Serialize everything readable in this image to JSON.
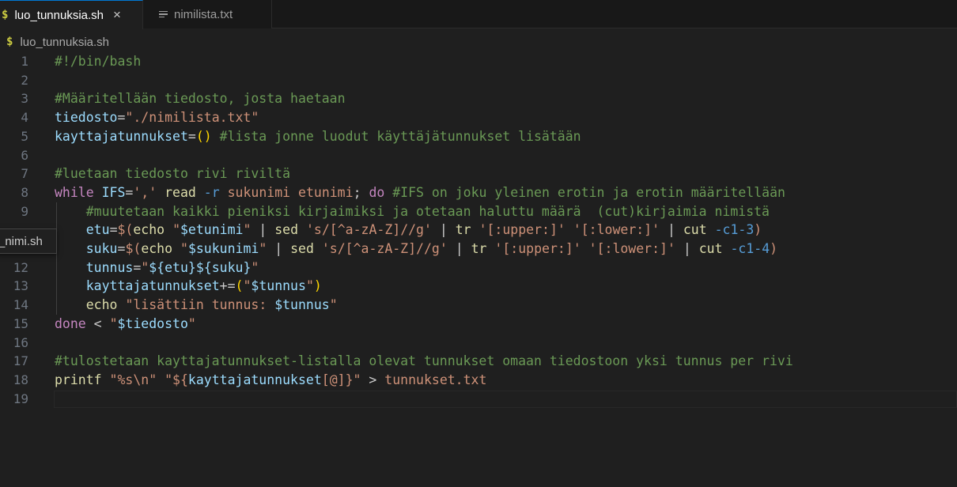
{
  "tabs": [
    {
      "icon": "$",
      "label": "luo_tunnuksia.sh",
      "active": true,
      "close": "×"
    },
    {
      "icon": "lines-icon",
      "label": "nimilista.txt",
      "active": false
    }
  ],
  "breadcrumb": {
    "icon": "$",
    "label": "luo_tunnuksia.sh"
  },
  "tooltip": {
    "text": "_nimi.sh"
  },
  "editor": {
    "line_numbers": [
      "1",
      "2",
      "3",
      "4",
      "5",
      "6",
      "7",
      "8",
      "9",
      "",
      "",
      "12",
      "13",
      "14",
      "15",
      "16",
      "17",
      "18",
      "19"
    ],
    "lines": [
      [
        [
          "cm",
          "#!/bin/bash"
        ]
      ],
      [],
      [
        [
          "cm",
          "#Määritellään tiedosto, josta haetaan"
        ]
      ],
      [
        [
          "var",
          "tiedosto"
        ],
        [
          "pl",
          "="
        ],
        [
          "str",
          "\"./nimilista.txt\""
        ]
      ],
      [
        [
          "var",
          "kayttajatunnukset"
        ],
        [
          "pl",
          "="
        ],
        [
          "br",
          "()"
        ],
        [
          "pl",
          " "
        ],
        [
          "cm",
          "#lista jonne luodut käyttäjätunnukset lisätään"
        ]
      ],
      [],
      [
        [
          "cm",
          "#luetaan tiedosto rivi riviltä"
        ]
      ],
      [
        [
          "kw",
          "while"
        ],
        [
          "pl",
          " "
        ],
        [
          "var",
          "IFS"
        ],
        [
          "pl",
          "="
        ],
        [
          "str",
          "','"
        ],
        [
          "pl",
          " "
        ],
        [
          "fn",
          "read"
        ],
        [
          "pl",
          " "
        ],
        [
          "op",
          "-r"
        ],
        [
          "pl",
          " "
        ],
        [
          "str",
          "sukunimi etunimi"
        ],
        [
          "pl",
          "; "
        ],
        [
          "kw",
          "do"
        ],
        [
          "pl",
          " "
        ],
        [
          "cm",
          "#IFS on joku yleinen erotin ja erotin määritellään"
        ]
      ],
      [
        [
          "pl",
          "    "
        ],
        [
          "cm",
          "#muutetaan kaikki pieniksi kirjaimiksi ja otetaan haluttu määrä  (cut)kirjaimia nimistä"
        ]
      ],
      [
        [
          "pl",
          "    "
        ],
        [
          "var",
          "etu"
        ],
        [
          "pl",
          "="
        ],
        [
          "str",
          "$("
        ],
        [
          "fn",
          "echo"
        ],
        [
          "pl",
          " "
        ],
        [
          "str",
          "\""
        ],
        [
          "var",
          "$etunimi"
        ],
        [
          "str",
          "\""
        ],
        [
          "pl",
          " | "
        ],
        [
          "fn",
          "sed"
        ],
        [
          "pl",
          " "
        ],
        [
          "str",
          "'s/[^a-zA-Z]//g'"
        ],
        [
          "pl",
          " | "
        ],
        [
          "fn",
          "tr"
        ],
        [
          "pl",
          " "
        ],
        [
          "str",
          "'[:upper:]'"
        ],
        [
          "pl",
          " "
        ],
        [
          "str",
          "'[:lower:]'"
        ],
        [
          "pl",
          " | "
        ],
        [
          "fn",
          "cut"
        ],
        [
          "pl",
          " "
        ],
        [
          "op",
          "-c1-3"
        ],
        [
          "str",
          ")"
        ]
      ],
      [
        [
          "pl",
          "    "
        ],
        [
          "var",
          "suku"
        ],
        [
          "pl",
          "="
        ],
        [
          "str",
          "$("
        ],
        [
          "fn",
          "echo"
        ],
        [
          "pl",
          " "
        ],
        [
          "str",
          "\""
        ],
        [
          "var",
          "$sukunimi"
        ],
        [
          "str",
          "\""
        ],
        [
          "pl",
          " | "
        ],
        [
          "fn",
          "sed"
        ],
        [
          "pl",
          " "
        ],
        [
          "str",
          "'s/[^a-zA-Z]//g'"
        ],
        [
          "pl",
          " | "
        ],
        [
          "fn",
          "tr"
        ],
        [
          "pl",
          " "
        ],
        [
          "str",
          "'[:upper:]'"
        ],
        [
          "pl",
          " "
        ],
        [
          "str",
          "'[:lower:]'"
        ],
        [
          "pl",
          " | "
        ],
        [
          "fn",
          "cut"
        ],
        [
          "pl",
          " "
        ],
        [
          "op",
          "-c1-4"
        ],
        [
          "str",
          ")"
        ]
      ],
      [
        [
          "pl",
          "    "
        ],
        [
          "var",
          "tunnus"
        ],
        [
          "pl",
          "="
        ],
        [
          "str",
          "\""
        ],
        [
          "var",
          "${etu}${suku}"
        ],
        [
          "str",
          "\""
        ]
      ],
      [
        [
          "pl",
          "    "
        ],
        [
          "var",
          "kayttajatunnukset"
        ],
        [
          "pl",
          "+="
        ],
        [
          "br",
          "("
        ],
        [
          "str",
          "\""
        ],
        [
          "var",
          "$tunnus"
        ],
        [
          "str",
          "\""
        ],
        [
          "br",
          ")"
        ]
      ],
      [
        [
          "pl",
          "    "
        ],
        [
          "fn",
          "echo"
        ],
        [
          "pl",
          " "
        ],
        [
          "str",
          "\"lisättiin tunnus: "
        ],
        [
          "var",
          "$tunnus"
        ],
        [
          "str",
          "\""
        ]
      ],
      [
        [
          "kw",
          "done"
        ],
        [
          "pl",
          " < "
        ],
        [
          "str",
          "\""
        ],
        [
          "var",
          "$tiedosto"
        ],
        [
          "str",
          "\""
        ]
      ],
      [],
      [
        [
          "cm",
          "#tulostetaan kayttajatunnukset-listalla olevat tunnukset omaan tiedostoon yksi tunnus per rivi"
        ]
      ],
      [
        [
          "fn",
          "printf"
        ],
        [
          "pl",
          " "
        ],
        [
          "str",
          "\"%s\\n\""
        ],
        [
          "pl",
          " "
        ],
        [
          "str",
          "\"${"
        ],
        [
          "var",
          "kayttajatunnukset"
        ],
        [
          "str",
          "[@]}\""
        ],
        [
          "pl",
          " > "
        ],
        [
          "str",
          "tunnukset.txt"
        ]
      ],
      []
    ]
  }
}
